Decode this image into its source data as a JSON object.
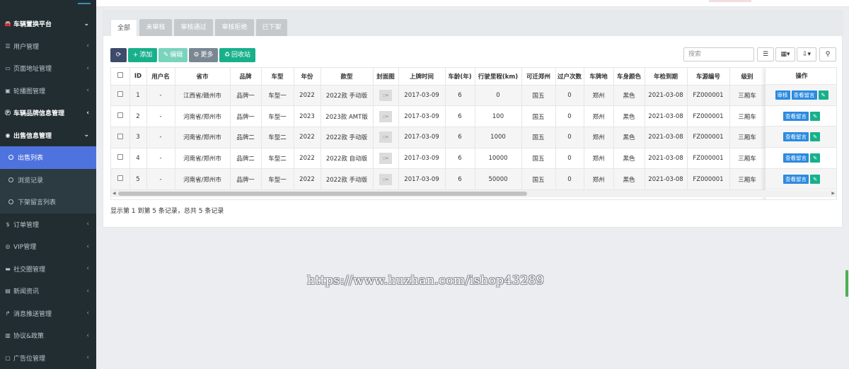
{
  "sidebar": {
    "items": [
      {
        "label": "车辆置换平台",
        "icon": "car-icon",
        "type": "group",
        "arrow": "⌄"
      },
      {
        "label": "用户管理",
        "icon": "list-icon",
        "type": "item",
        "arrow": "‹"
      },
      {
        "label": "页面地址管理",
        "icon": "window-icon",
        "type": "item",
        "arrow": "‹"
      },
      {
        "label": "轮播图管理",
        "icon": "image-icon",
        "type": "item",
        "arrow": "‹"
      },
      {
        "label": "车辆品牌信息管理",
        "icon": "parking-icon",
        "type": "group",
        "arrow": "‹"
      },
      {
        "label": "出售信息管理",
        "icon": "eye-icon",
        "type": "group",
        "arrow": "⌄"
      },
      {
        "label": "出售列表",
        "icon": "circle-icon",
        "type": "sub-active",
        "arrow": ""
      },
      {
        "label": "浏览记录",
        "icon": "circle-icon",
        "type": "sub",
        "arrow": ""
      },
      {
        "label": "下架留言列表",
        "icon": "circle-icon",
        "type": "sub",
        "arrow": ""
      },
      {
        "label": "订单管理",
        "icon": "dollar-icon",
        "type": "item",
        "arrow": "‹"
      },
      {
        "label": "VIP管理",
        "icon": "user-circle-icon",
        "type": "item",
        "arrow": "‹"
      },
      {
        "label": "社交圈管理",
        "icon": "desktop-icon",
        "type": "item",
        "arrow": "‹"
      },
      {
        "label": "新闻资讯",
        "icon": "news-icon",
        "type": "item",
        "arrow": "‹"
      },
      {
        "label": "消息推送管理",
        "icon": "share-icon",
        "type": "item",
        "arrow": "‹"
      },
      {
        "label": "协议&政策",
        "icon": "doc-icon",
        "type": "item",
        "arrow": "‹"
      },
      {
        "label": "广告位管理",
        "icon": "ad-icon",
        "type": "item",
        "arrow": "‹"
      }
    ]
  },
  "tabs": [
    "全部",
    "未审核",
    "审核通过",
    "审核拒绝",
    "已下架"
  ],
  "toolbar": {
    "refresh_icon": "refresh-icon",
    "add_label": "添加",
    "edit_label": "编辑",
    "more_label": "更多",
    "recycle_label": "回收站",
    "search_placeholder": "搜索"
  },
  "table": {
    "columns": [
      "ID",
      "用户名",
      "省市",
      "品牌",
      "车型",
      "年份",
      "款型",
      "封面图",
      "上牌时间",
      "车龄(年)",
      "行驶里程(km)",
      "可迁郑州",
      "过户次数",
      "车牌地",
      "车身颜色",
      "年检到期",
      "车源编号",
      "级别"
    ],
    "ops_header": "操作",
    "thumb_text": "□№",
    "rows": [
      {
        "cells": [
          "1",
          "-",
          "江西省/赣州市",
          "品牌一",
          "车型一",
          "2022",
          "2022款 手动版",
          "",
          "2017-03-09",
          "6",
          "0",
          "国五",
          "0",
          "郑州",
          "黑色",
          "2021-03-08",
          "FZ000001",
          "三厢车"
        ],
        "ops": [
          "审核",
          "查看留言"
        ]
      },
      {
        "cells": [
          "2",
          "-",
          "河南省/郑州市",
          "品牌一",
          "车型一",
          "2023",
          "2023款 AMT版",
          "",
          "2017-03-09",
          "6",
          "100",
          "国五",
          "0",
          "郑州",
          "黑色",
          "2021-03-08",
          "FZ000001",
          "三厢车"
        ],
        "ops": [
          "查看留言"
        ]
      },
      {
        "cells": [
          "3",
          "-",
          "河南省/郑州市",
          "品牌二",
          "车型二",
          "2022",
          "2022款 手动版",
          "",
          "2017-03-09",
          "6",
          "1000",
          "国五",
          "0",
          "郑州",
          "黑色",
          "2021-03-08",
          "FZ000001",
          "三厢车"
        ],
        "ops": [
          "查看留言"
        ]
      },
      {
        "cells": [
          "4",
          "-",
          "河南省/郑州市",
          "品牌二",
          "车型二",
          "2022",
          "2022款 自动版",
          "",
          "2017-03-09",
          "6",
          "10000",
          "国五",
          "0",
          "郑州",
          "黑色",
          "2021-03-08",
          "FZ000001",
          "三厢车"
        ],
        "ops": [
          "查看留言"
        ]
      },
      {
        "cells": [
          "5",
          "-",
          "河南省/郑州市",
          "品牌一",
          "车型一",
          "2022",
          "2022款 手动版",
          "",
          "2017-03-09",
          "6",
          "50000",
          "国五",
          "0",
          "郑州",
          "黑色",
          "2021-03-08",
          "FZ000001",
          "三厢车"
        ],
        "ops": [
          "查看留言"
        ]
      }
    ]
  },
  "pagination_text": "显示第 1 到第 5 条记录，总共 5 条记录",
  "watermark_text": "https://www.huzhan.com/ishop43289",
  "colors": {
    "sidebar_bg": "#222d32",
    "active_item": "#4e73df",
    "primary_green": "#18b08b",
    "primary_blue": "#2b8ae0"
  }
}
